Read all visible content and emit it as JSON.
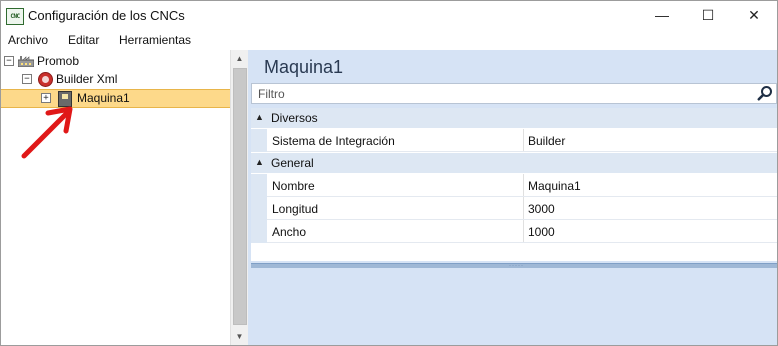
{
  "window": {
    "title": "Configuración de los CNCs",
    "app_icon_text": "CNC",
    "controls": {
      "minimize": "—",
      "maximize": "☐",
      "close": "✕"
    }
  },
  "menu": {
    "items": [
      "Archivo",
      "Editar",
      "Herramientas"
    ]
  },
  "tree": {
    "nodes": [
      {
        "label": "Promob",
        "expander": "−",
        "icon": "factory-icon"
      },
      {
        "label": "Builder Xml",
        "expander": "−",
        "icon": "builder-icon"
      },
      {
        "label": "Maquina1",
        "expander": "+",
        "icon": "machine-icon",
        "selected": true
      }
    ],
    "selection_color": "#fdd98a"
  },
  "scrollbar": {
    "up": "▲",
    "down": "▼"
  },
  "details": {
    "title": "Maquina1",
    "filter": {
      "placeholder": "Filtro",
      "value": ""
    },
    "categories": [
      {
        "label": "Diversos",
        "properties": [
          {
            "name": "Sistema de Integración",
            "value": "Builder"
          }
        ]
      },
      {
        "label": "General",
        "properties": [
          {
            "name": "Nombre",
            "value": "Maquina1"
          },
          {
            "name": "Longitud",
            "value": "3000"
          },
          {
            "name": "Ancho",
            "value": "1000"
          }
        ]
      }
    ],
    "collapse_glyph": "▲",
    "splitter_grip": "·····"
  },
  "colors": {
    "panel_bg": "#d6e3f5",
    "category_bg": "#dde7f3",
    "annotation_arrow": "#e01818"
  }
}
